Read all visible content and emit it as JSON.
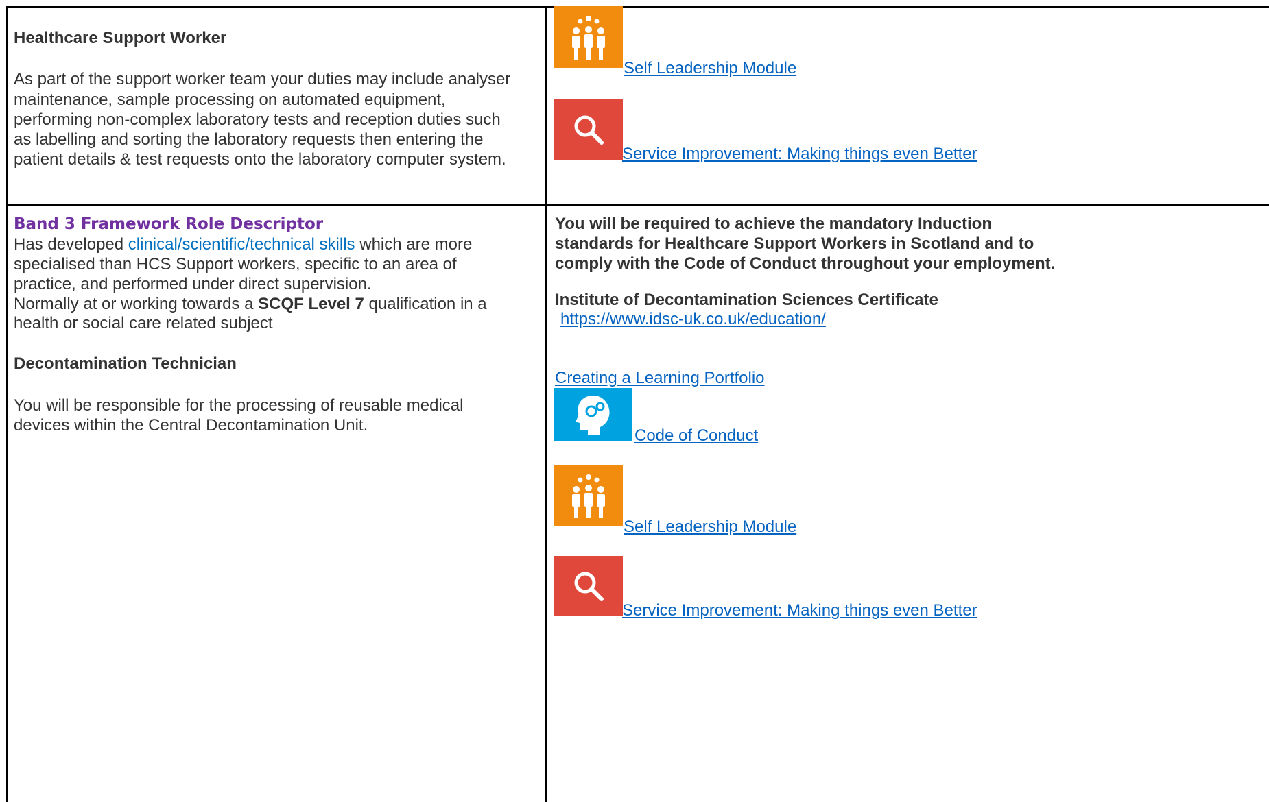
{
  "left_top": {
    "title": "Healthcare Support Worker",
    "lines": [
      "As part of the support worker team your duties may include analyser",
      "maintenance, sample processing on automated equipment,",
      "performing non-complex laboratory tests and reception duties such",
      "as labelling and sorting the laboratory requests then entering the",
      "patient details & test requests onto the laboratory computer system."
    ]
  },
  "right_top": {
    "links": [
      {
        "label": "Self Leadership Module",
        "icon": "people-icon"
      },
      {
        "label": "Service Improvement: Making things even Better",
        "icon": "search-icon"
      }
    ]
  },
  "left_bottom": {
    "heading": "Band 3 Framework Role Descriptor",
    "line1_pre": "Has developed ",
    "line1_link": "clinical/scientific/technical skills",
    "line1_post": " which are more",
    "line2": "specialised than HCS Support workers, specific to an area of",
    "line3": "practice, and performed under direct supervision.",
    "line4_pre": "Normally at or working towards a ",
    "line4_bold": "SCQF Level 7",
    "line4_post": " qualification in a",
    "line5": "health or social care related subject",
    "role_title": "Decontamination Technician",
    "role_line1": "You will be responsible for the processing of reusable medical",
    "role_line2": "devices within the Central Decontamination Unit."
  },
  "right_bottom": {
    "req_lines": [
      "You will be required to achieve the mandatory Induction",
      "standards for Healthcare Support Workers in Scotland and to",
      "comply with the Code of Conduct throughout your employment."
    ],
    "cert_title": "Institute of Decontamination Sciences Certificate",
    "cert_url": "https://www.idsc-uk.co.uk/education/",
    "portfolio_link": "Creating a Learning Portfolio",
    "links": [
      {
        "label": "Code of Conduct",
        "icon": "brain-gears-icon"
      },
      {
        "label": "Self Leadership Module",
        "icon": "people-icon"
      },
      {
        "label": "Service Improvement: Making things even Better",
        "icon": "search-icon"
      }
    ]
  },
  "colors": {
    "link": "#0563c1",
    "heading_purple": "#7030a0",
    "skill_blue": "#0070c0",
    "icon_orange": "#f28c0f",
    "icon_red": "#e0483c",
    "icon_cyan": "#00a2e0"
  }
}
